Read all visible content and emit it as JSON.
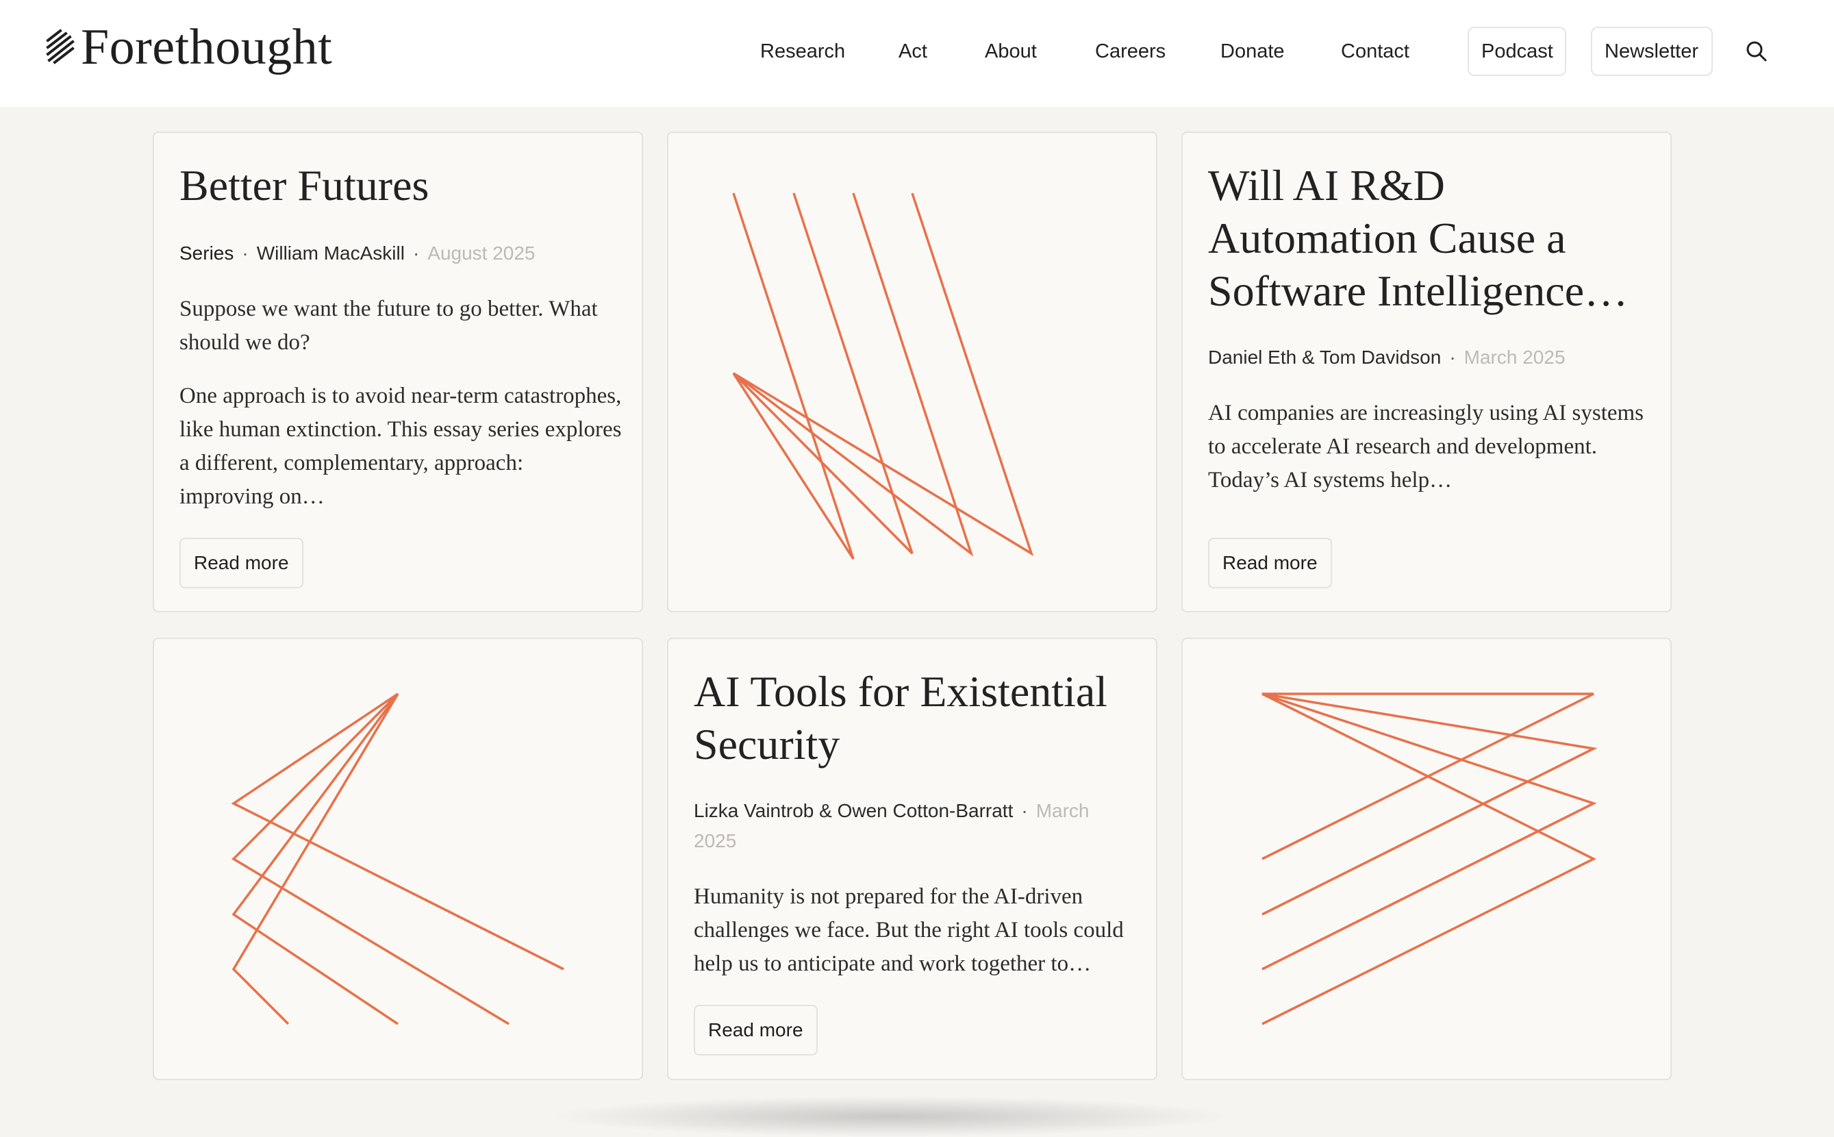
{
  "header": {
    "logo_text": "Forethought",
    "nav": [
      "Research",
      "Act",
      "About",
      "Careers",
      "Donate",
      "Contact"
    ],
    "buttons": {
      "podcast": "Podcast",
      "newsletter": "Newsletter"
    }
  },
  "accent_color": "#e8714a",
  "cards": {
    "better_futures": {
      "title": "Better Futures",
      "type": "Series",
      "author": "William MacAskill",
      "separator": "·",
      "date": "August 2025",
      "excerpt_1": "Suppose we want the future to go better. What should we do?",
      "excerpt_2": "One approach is to avoid near-term catastrophes, like human extinction. This essay series explores a different, complementary, approach: improving on…",
      "read_more": "Read more"
    },
    "ai_rd": {
      "title": "Will AI R&D Automation Cause a Software Intelligence…",
      "author": "Daniel Eth & Tom Davidson",
      "separator": "·",
      "date": "March 2025",
      "excerpt": "AI companies are increasingly using AI systems to accelerate AI research and development. Today’s AI systems help…",
      "read_more": "Read more"
    },
    "ai_tools": {
      "title": "AI Tools for Existential Security",
      "author": "Lizka Vaintrob & Owen Cotton-Barratt",
      "separator": "·",
      "date": "March 2025",
      "excerpt": "Humanity is not prepared for the AI-driven challenges we face. But the right AI tools could help us to anticipate and work together to…",
      "read_more": "Read more"
    }
  }
}
